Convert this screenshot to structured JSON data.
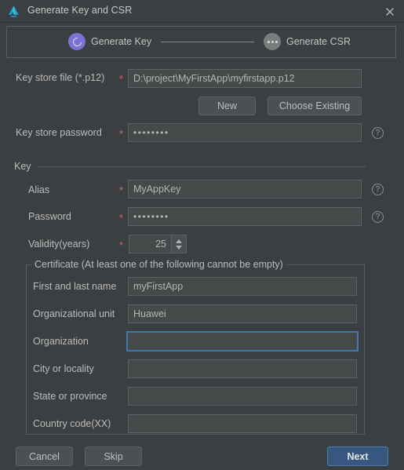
{
  "window": {
    "title": "Generate Key and CSR",
    "logo_icon": "deveco-logo-icon",
    "close_icon": "close-icon"
  },
  "stepper": {
    "steps": [
      {
        "label": "Generate Key",
        "state": "active",
        "icon": "spinner-ring-icon"
      },
      {
        "label": "Generate CSR",
        "state": "inactive",
        "icon": "ellipsis-icon"
      }
    ]
  },
  "form": {
    "key_store_file": {
      "label": "Key store file (*.p12)",
      "required_marker": "*",
      "value": "D:\\project\\MyFirstApp\\myfirstapp.p12",
      "placeholder": ""
    },
    "new_button": "New",
    "choose_existing_button": "Choose Existing",
    "key_store_password": {
      "label": "Key store password",
      "required_marker": "*",
      "value": "••••••••",
      "placeholder": "",
      "help_icon": "help-icon"
    }
  },
  "key_section": {
    "title": "Key",
    "alias": {
      "label": "Alias",
      "required_marker": "*",
      "value": "MyAppKey",
      "placeholder": "",
      "help_icon": "help-icon"
    },
    "password": {
      "label": "Password",
      "required_marker": "*",
      "value": "••••••••",
      "placeholder": "",
      "help_icon": "help-icon"
    },
    "validity": {
      "label": "Validity(years)",
      "required_marker": "*",
      "value": "25"
    }
  },
  "certificate": {
    "title": "Certificate (At least one of the following cannot be empty)",
    "fields": [
      {
        "label": "First and last name",
        "value": "myFirstApp",
        "placeholder": "",
        "focused": false
      },
      {
        "label": "Organizational unit",
        "value": "Huawei",
        "placeholder": "",
        "focused": false
      },
      {
        "label": "Organization",
        "value": "",
        "placeholder": "",
        "focused": true
      },
      {
        "label": "City or locality",
        "value": "",
        "placeholder": "",
        "focused": false
      },
      {
        "label": "State or province",
        "value": "",
        "placeholder": "",
        "focused": false
      },
      {
        "label": "Country code(XX)",
        "value": "",
        "placeholder": "",
        "focused": false
      }
    ]
  },
  "footer": {
    "cancel": "Cancel",
    "skip": "Skip",
    "next": "Next"
  },
  "colors": {
    "background": "#3c3f41",
    "input_background": "#45494a",
    "border": "#5e6163",
    "accent_primary": "#365880",
    "focus_border": "#3f76b6",
    "required_red": "#d2676a",
    "step_active": "#7c72d6",
    "step_inactive": "#7a7d7e"
  }
}
